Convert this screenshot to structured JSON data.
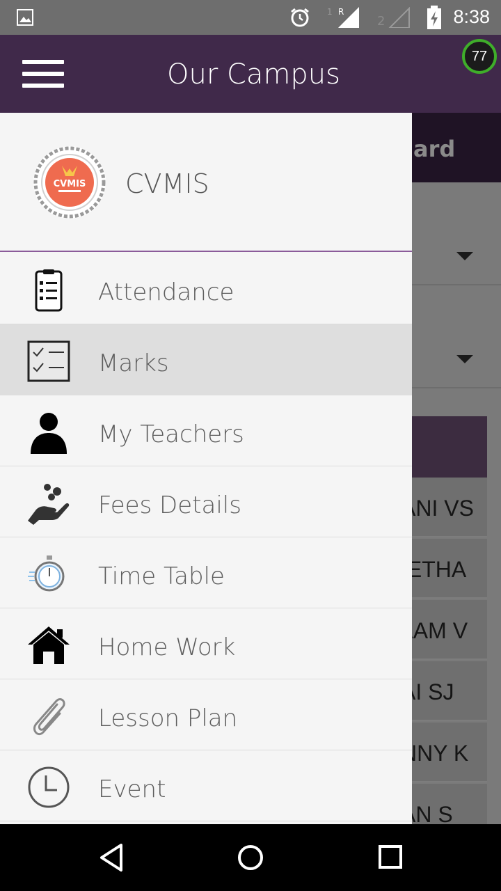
{
  "status_bar": {
    "time": "8:38",
    "icons": [
      "image-icon",
      "alarm-icon",
      "signal-icon",
      "signal-empty-icon",
      "battery-charging-icon"
    ]
  },
  "app_bar": {
    "title": "Our Campus",
    "menu_icon": "hamburger-icon",
    "badge_value": "77"
  },
  "drawer": {
    "school_name": "CVMIS",
    "logo_text": "CVMIS",
    "items": [
      {
        "label": "Attendance",
        "icon": "clipboard-icon",
        "active": false
      },
      {
        "label": "Marks",
        "icon": "checklist-icon",
        "active": true
      },
      {
        "label": "My Teachers",
        "icon": "person-icon",
        "active": false
      },
      {
        "label": "Fees Details",
        "icon": "hand-coins-icon",
        "active": false
      },
      {
        "label": "Time Table",
        "icon": "stopwatch-icon",
        "active": false
      },
      {
        "label": "Home Work",
        "icon": "home-icon",
        "active": false
      },
      {
        "label": "Lesson Plan",
        "icon": "paperclip-icon",
        "active": false
      },
      {
        "label": "Event",
        "icon": "clock-icon",
        "active": false
      }
    ]
  },
  "background": {
    "header_text": "ard",
    "rows": [
      "ANI VS",
      "IETHA",
      "LAM V",
      "AI SJ",
      "NNY K",
      "AN S"
    ]
  },
  "colors": {
    "primary": "#40294a",
    "divider_accent": "#8b5b9a",
    "active_item": "#dedede"
  }
}
